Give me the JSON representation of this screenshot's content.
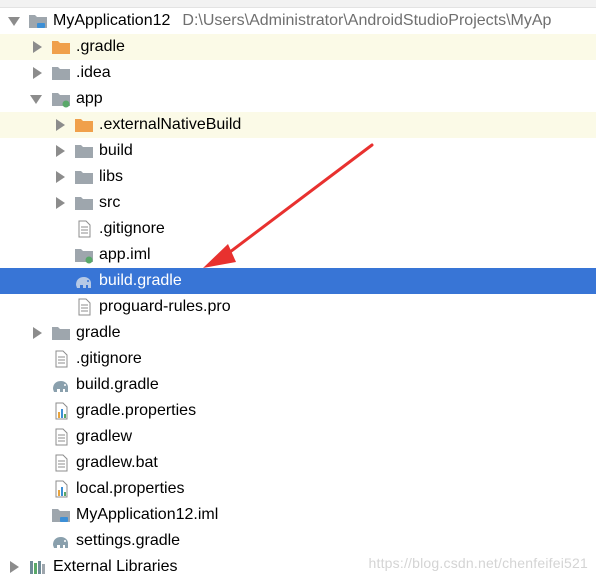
{
  "tree": {
    "root": {
      "label": "MyApplication12",
      "path": "D:\\Users\\Administrator\\AndroidStudioProjects\\MyAp"
    },
    "items": [
      {
        "label": ".gradle",
        "icon": "folder-orange-icon"
      },
      {
        "label": ".idea",
        "icon": "folder-icon"
      },
      {
        "label": "app",
        "icon": "module-folder-icon"
      },
      {
        "label": ".externalNativeBuild",
        "icon": "folder-orange-icon"
      },
      {
        "label": "build",
        "icon": "folder-icon"
      },
      {
        "label": "libs",
        "icon": "folder-icon"
      },
      {
        "label": "src",
        "icon": "folder-icon"
      },
      {
        "label": ".gitignore",
        "icon": "text-file-icon"
      },
      {
        "label": "app.iml",
        "icon": "iml-file-icon"
      },
      {
        "label": "build.gradle",
        "icon": "gradle-elephant-icon"
      },
      {
        "label": "proguard-rules.pro",
        "icon": "text-file-icon"
      },
      {
        "label": "gradle",
        "icon": "folder-icon"
      },
      {
        "label": ".gitignore",
        "icon": "text-file-icon"
      },
      {
        "label": "build.gradle",
        "icon": "gradle-elephant-icon"
      },
      {
        "label": "gradle.properties",
        "icon": "properties-file-icon"
      },
      {
        "label": "gradlew",
        "icon": "text-file-icon"
      },
      {
        "label": "gradlew.bat",
        "icon": "text-file-icon"
      },
      {
        "label": "local.properties",
        "icon": "properties-file-icon"
      },
      {
        "label": "MyApplication12.iml",
        "icon": "iml-file-icon"
      },
      {
        "label": "settings.gradle",
        "icon": "gradle-elephant-icon"
      },
      {
        "label": "External Libraries",
        "icon": "library-icon"
      }
    ]
  },
  "selection": {
    "selected_item": "build.gradle",
    "under": "app"
  },
  "colors": {
    "selection": "#3875d6",
    "excluded_bg": "#fbfae7",
    "folder": "#9ea6ad",
    "folder_orange": "#f0a04b",
    "annotation_arrow": "#e8312f"
  },
  "watermark": "https://blog.csdn.net/chenfeifei521"
}
